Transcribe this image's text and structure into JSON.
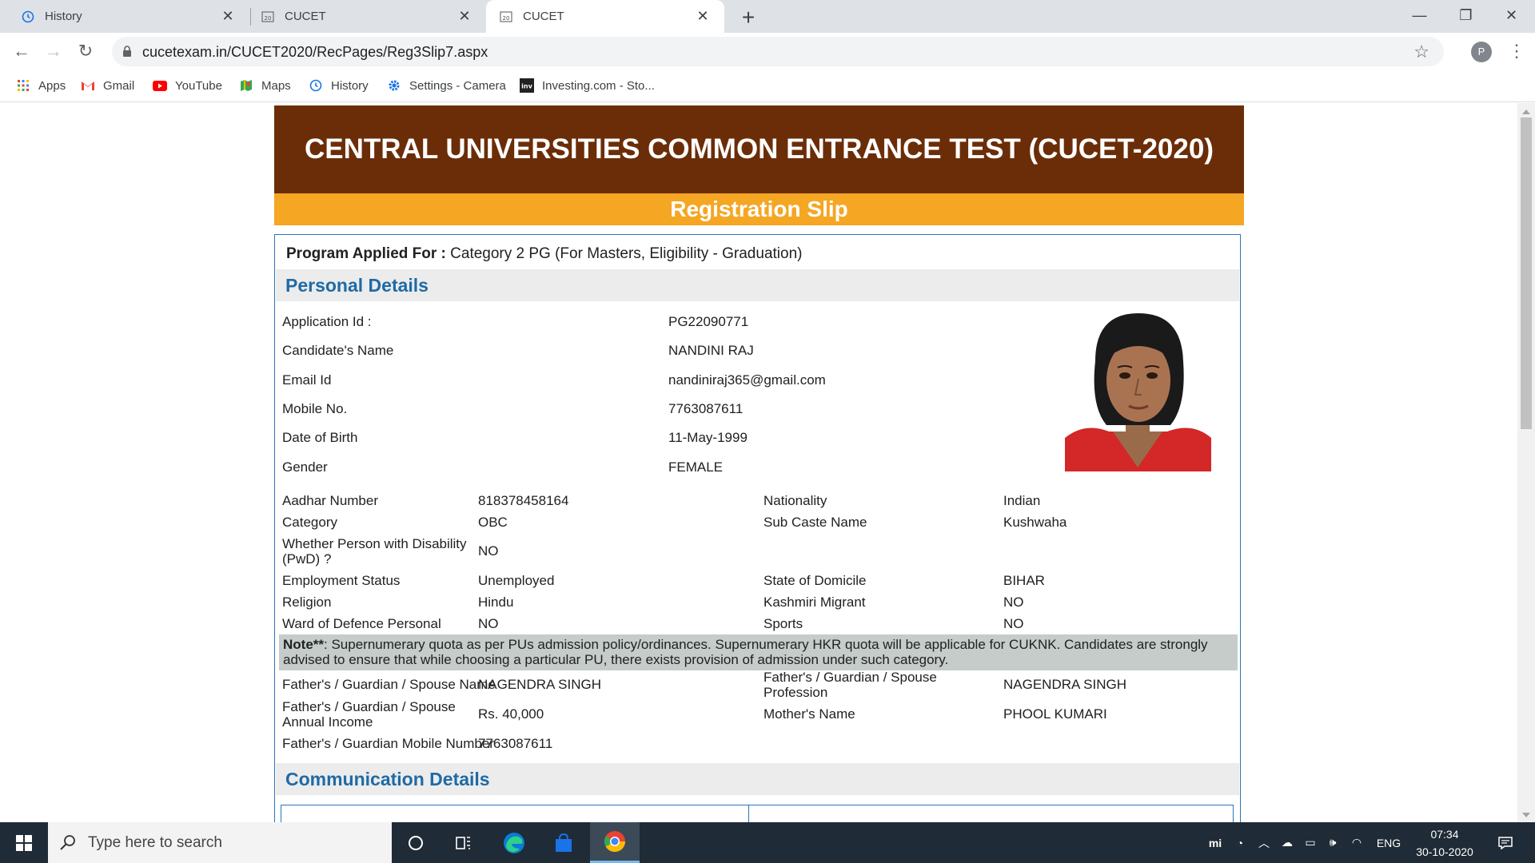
{
  "browser": {
    "tabs": [
      {
        "title": "History",
        "icon": "history-icon",
        "active": false
      },
      {
        "title": "CUCET",
        "icon": "cucet-favicon",
        "active": false
      },
      {
        "title": "CUCET",
        "icon": "cucet-favicon",
        "active": true
      }
    ],
    "url": "cucetexam.in/CUCET2020/RecPages/Reg3Slip7.aspx",
    "profile_initial": "P",
    "bookmarks": [
      {
        "label": "Apps",
        "icon": "apps-grid-icon"
      },
      {
        "label": "Gmail",
        "icon": "gmail-icon"
      },
      {
        "label": "YouTube",
        "icon": "youtube-icon"
      },
      {
        "label": "Maps",
        "icon": "maps-icon"
      },
      {
        "label": "History",
        "icon": "history-icon"
      },
      {
        "label": "Settings - Camera",
        "icon": "settings-gear-icon"
      },
      {
        "label": "Investing.com - Sto...",
        "icon": "investing-icon"
      }
    ]
  },
  "page": {
    "title": "CENTRAL UNIVERSITIES COMMON ENTRANCE TEST (CUCET-2020)",
    "subtitle": "Registration Slip",
    "program_label": "Program Applied For :",
    "program_value": " Category 2 PG (For Masters, Eligibility - Graduation)",
    "personal_header": "Personal Details",
    "top_fields": [
      {
        "label": "Application Id :",
        "value": "PG22090771"
      },
      {
        "label": "Candidate's Name",
        "value": "NANDINI RAJ"
      },
      {
        "label": "Email Id",
        "value": "nandiniraj365@gmail.com"
      },
      {
        "label": "Mobile No.",
        "value": "7763087611"
      },
      {
        "label": "Date of Birth",
        "value": "11-May-1999"
      },
      {
        "label": "Gender",
        "value": "FEMALE"
      }
    ],
    "grid_rows": [
      {
        "l1": "Aadhar Number",
        "v1": "818378458164",
        "l2": "Nationality",
        "v2": "Indian"
      },
      {
        "l1": "Category",
        "v1": "OBC",
        "l2": "Sub Caste Name",
        "v2": "Kushwaha"
      },
      {
        "l1": "Whether Person with Disability (PwD) ?",
        "v1": "NO",
        "l2": "",
        "v2": ""
      },
      {
        "l1": "Employment Status",
        "v1": "Unemployed",
        "l2": "State of Domicile",
        "v2": "BIHAR"
      },
      {
        "l1": "Religion",
        "v1": "Hindu",
        "l2": "Kashmiri Migrant",
        "v2": "NO"
      },
      {
        "l1": "Ward of Defence Personal",
        "v1": "NO",
        "l2": "Sports",
        "v2": "NO"
      }
    ],
    "note_bold": "Note**",
    "note_text": ": Supernumerary quota as per PUs admission policy/ordinances. Supernumerary HKR quota will be applicable for CUKNK. Candidates are strongly advised to ensure that while choosing a particular PU, there exists provision of admission under such category.",
    "family_rows": [
      {
        "l1": "Father's / Guardian / Spouse Name",
        "v1": "NAGENDRA SINGH",
        "l2": "Father's / Guardian / Spouse Profession",
        "v2": "NAGENDRA SINGH"
      },
      {
        "l1": "Father's / Guardian / Spouse Annual Income",
        "v1": "Rs. 40,000",
        "l2": "Mother's Name",
        "v2": "PHOOL KUMARI"
      },
      {
        "l1": "Father's / Guardian Mobile Number",
        "v1": "7763087611",
        "l2": "",
        "v2": ""
      }
    ],
    "communication_header": "Communication Details"
  },
  "taskbar": {
    "search_placeholder": "Type here to search",
    "apps": [
      "task-view-icon",
      "edge-icon",
      "store-icon",
      "chrome-icon"
    ],
    "language": "ENG",
    "time": "07:34",
    "date": "30-10-2020"
  }
}
